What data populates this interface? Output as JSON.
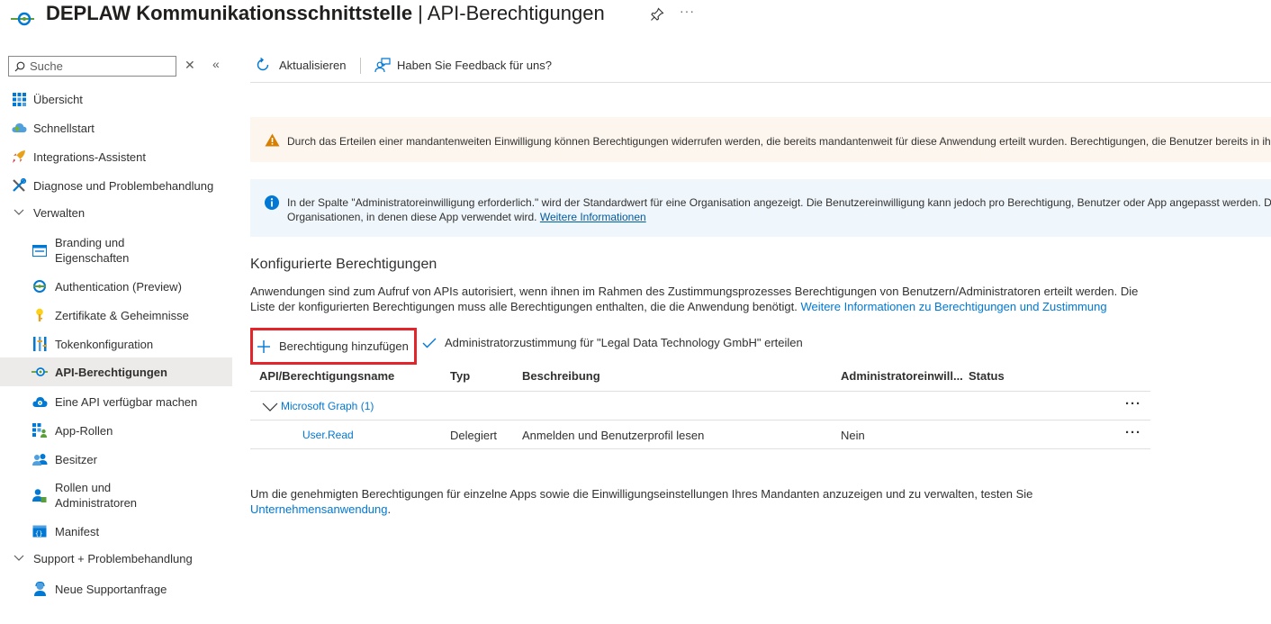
{
  "header": {
    "app_name": "DEPLAW Kommunikationsschnittstelle",
    "separator": " | ",
    "page_name": "API-Berechtigungen",
    "more_label": "···"
  },
  "sidebar": {
    "search_placeholder": "Suche",
    "close_glyph": "✕",
    "collapse_glyph": "«",
    "items": [
      {
        "label": "Übersicht",
        "icon": "grid-icon"
      },
      {
        "label": "Schnellstart",
        "icon": "cloud-icon"
      },
      {
        "label": "Integrations-Assistent",
        "icon": "rocket-icon"
      },
      {
        "label": "Diagnose und Problembehandlung",
        "icon": "wrench-icon"
      },
      {
        "label": "Verwalten",
        "icon": "chevron-down-icon"
      },
      {
        "label": "Branding und Eigenschaften",
        "icon": "card-icon"
      },
      {
        "label": "Authentication (Preview)",
        "icon": "auth-icon"
      },
      {
        "label": "Zertifikate & Geheimnisse",
        "icon": "key-icon"
      },
      {
        "label": "Tokenkonfiguration",
        "icon": "bars-icon"
      },
      {
        "label": "API-Berechtigungen",
        "icon": "api-icon"
      },
      {
        "label": "Eine API verfügbar machen",
        "icon": "cloud-api-icon"
      },
      {
        "label": "App-Rollen",
        "icon": "app-roles-icon"
      },
      {
        "label": "Besitzer",
        "icon": "people-icon"
      },
      {
        "label": "Rollen und Administratoren",
        "icon": "person-admin-icon"
      },
      {
        "label": "Manifest",
        "icon": "manifest-icon"
      },
      {
        "label": "Support + Problembehandlung",
        "icon": "chevron-down-icon"
      },
      {
        "label": "Neue Supportanfrage",
        "icon": "support-person-icon"
      }
    ]
  },
  "toolbar": {
    "refresh_label": "Aktualisieren",
    "feedback_label": "Haben Sie Feedback für uns?"
  },
  "banners": {
    "warning_text": "Durch das Erteilen einer mandantenweiten Einwilligung können Berechtigungen widerrufen werden, die bereits mandantenweit für diese Anwendung erteilt wurden. Berechtigungen, die Benutzer bereits in ihrem",
    "info_line1": "In der Spalte \"Administratoreinwilligung erforderlich.\" wird der Standardwert für eine Organisation angezeigt. Die Benutzereinwilligung kann jedoch pro Berechtigung, Benutzer oder App angepasst werden. Diese",
    "info_line2": "Organisationen, in denen diese App verwendet wird.",
    "info_link": "Weitere Informationen"
  },
  "section": {
    "title": "Konfigurierte Berechtigungen",
    "desc_line1": "Anwendungen sind zum Aufruf von APIs autorisiert, wenn ihnen im Rahmen des Zustimmungsprozesses Berechtigungen von Benutzern/Administratoren erteilt werden. Die",
    "desc_line2": "Liste der konfigurierten Berechtigungen muss alle Berechtigungen enthalten, die die Anwendung benötigt.",
    "desc_link": "Weitere Informationen zu Berechtigungen und Zustimmung"
  },
  "actions": {
    "add_label": "Berechtigung hinzufügen",
    "consent_label": "Administratorzustimmung für \"Legal Data Technology GmbH\" erteilen"
  },
  "table": {
    "headers": [
      "API/Berechtigungsname",
      "Typ",
      "Beschreibung",
      "Administratoreinwill...",
      "Status"
    ],
    "group": {
      "label": "Microsoft Graph (1)"
    },
    "rows": [
      {
        "name": "User.Read",
        "type": "Delegiert",
        "description": "Anmelden und Benutzerprofil lesen",
        "admin_consent": "Nein",
        "status": ""
      }
    ],
    "more_label": "···"
  },
  "footer": {
    "text": "Um die genehmigten Berechtigungen für einzelne Apps sowie die Einwilligungseinstellungen Ihres Mandanten anzuzeigen und zu verwalten, testen Sie",
    "link": "Unternehmensanwendung",
    "suffix": "."
  },
  "colors": {
    "accent": "#0078d4",
    "highlight_border": "#e3242b",
    "warning_bg": "#fdf6ee",
    "info_bg": "#eff6fc",
    "active_nav_bg": "#edebe9"
  }
}
